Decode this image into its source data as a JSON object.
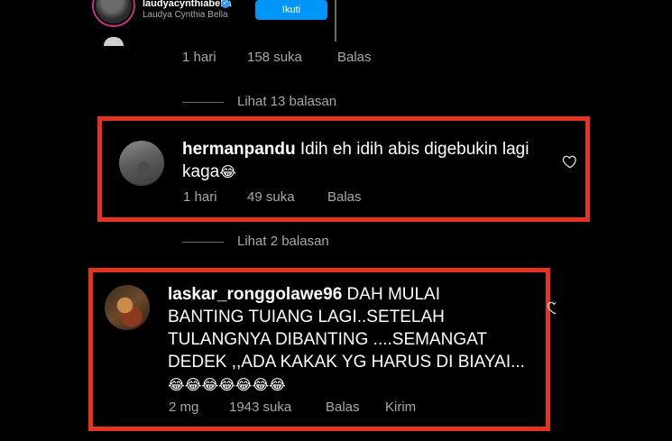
{
  "post": {
    "username": "laudyacynthiabella",
    "full_name": "Laudya Cynthia Bella",
    "follow_label": "Ikuti",
    "verified_glyph": "✓"
  },
  "first_comment_meta": {
    "time": "1 hari",
    "likes": "158 suka",
    "reply": "Balas"
  },
  "view_replies_1": "Lihat 13 balasan",
  "comment1": {
    "username": "hermanpandu",
    "text_line1": "Idih eh idih abis digebukin lagi",
    "text_line2": "kaga",
    "emoji": "😂",
    "time": "1 hari",
    "likes": "49 suka",
    "reply": "Balas"
  },
  "view_replies_2": "Lihat 2 balasan",
  "comment2": {
    "username": "laskar_ronggolawe96",
    "text_line1": "DAH MULAI",
    "text_line2": "BANTING TUIANG LAGI..SETELAH",
    "text_line3": "TULANGNYA DIBANTING ....SEMANGAT",
    "text_line4": "DEDEK ,,ADA KAKAK YG HARUS DI BIAYAI...",
    "emojis": "😂😂😂😂😂😂😂",
    "time": "2 mg",
    "likes": "1943 suka",
    "reply": "Balas",
    "send": "Kirim"
  },
  "colors": {
    "highlight_border": "#e53323",
    "follow_button": "#0095f6",
    "muted_text": "#a8a8a8"
  },
  "icons": {
    "like": "heart-outline-icon",
    "verified": "verified-badge-icon"
  }
}
